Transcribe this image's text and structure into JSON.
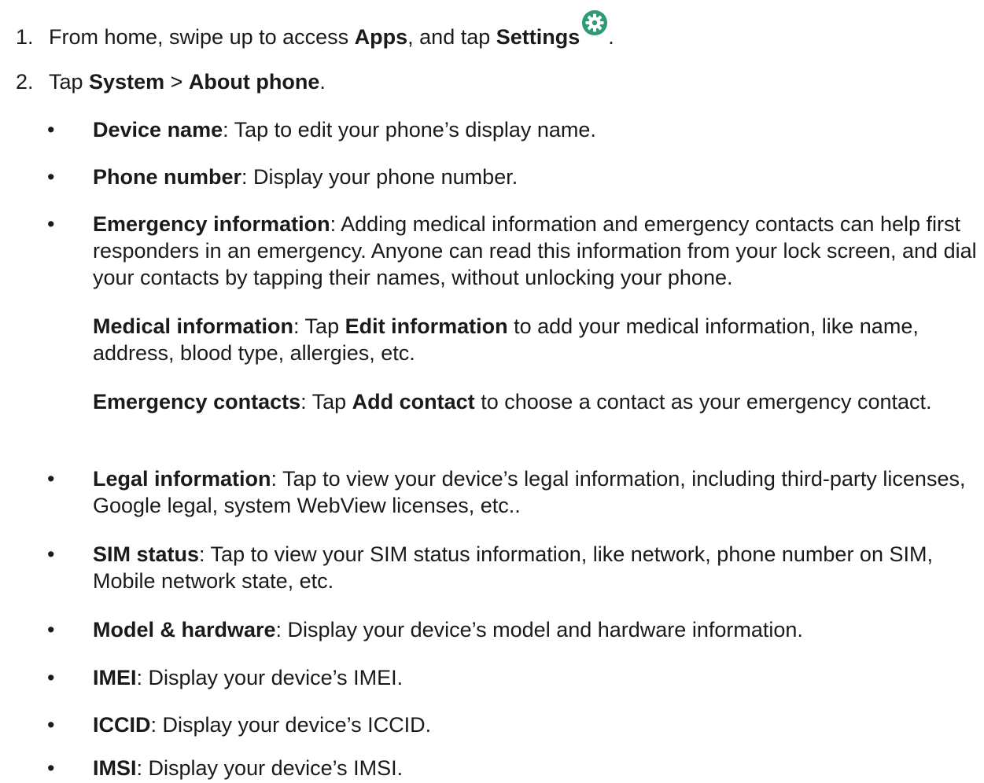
{
  "step1": {
    "number": "1.",
    "pre": "From home, swipe up to access ",
    "apps": "Apps",
    "mid": ", and tap ",
    "settings": "Settings",
    "post": ".",
    "icon": "settings-gear-icon",
    "icon_color": "#2e9a78"
  },
  "step2": {
    "number": "2.",
    "pre": "Tap ",
    "system": "System",
    "sep": " > ",
    "about": "About phone",
    "post": "."
  },
  "bullet_char": "•",
  "items": [
    {
      "term": "Device name",
      "desc": ": Tap to edit your phone’s display name."
    },
    {
      "term": "Phone number",
      "desc": ": Display your phone number."
    },
    {
      "term": "Emergency information",
      "desc": ": Adding medical information and emergency contacts can help first responders in an emergency. Anyone can read this information from your lock screen, and dial your contacts by tapping their names, without unlocking your phone."
    },
    {
      "term": "Legal information",
      "desc": ": Tap to view your device’s legal information, including third-party licenses, Google legal, system WebView licenses, etc.."
    },
    {
      "term": "SIM status",
      "desc": ": Tap to view your SIM status information, like network, phone number on SIM, Mobile network state, etc."
    },
    {
      "term": "Model & hardware",
      "desc": ": Display your device’s model and hardware information."
    },
    {
      "term": "IMEI",
      "desc": ": Display your device’s IMEI."
    },
    {
      "term": "ICCID",
      "desc": ": Display your device’s ICCID."
    },
    {
      "term": "IMSI",
      "desc": ": Display your device’s IMSI."
    }
  ],
  "medical": {
    "term": "Medical information",
    "pre": ": Tap ",
    "action": "Edit information",
    "post": " to add your medical information, like name, address, blood type, allergies, etc."
  },
  "contacts": {
    "term": "Emergency contacts",
    "pre": ": Tap ",
    "action": "Add contact",
    "post": " to choose a contact as your emergency contact."
  }
}
